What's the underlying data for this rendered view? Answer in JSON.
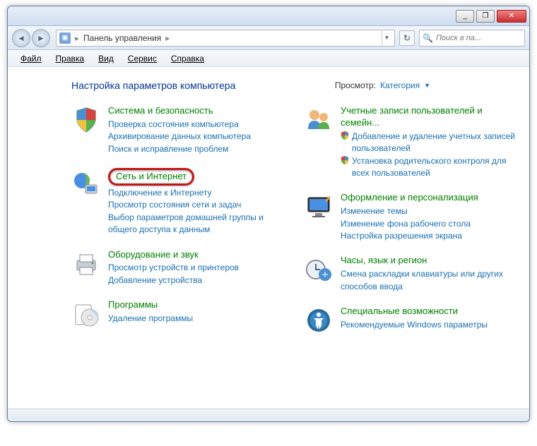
{
  "titlebar": {
    "min": "_",
    "max": "❐",
    "close": "✕"
  },
  "nav": {
    "back": "◄",
    "fwd": "►",
    "refresh": "↻"
  },
  "address": {
    "label": "Панель управления",
    "sep": "▸",
    "dropdown": "▾"
  },
  "search": {
    "placeholder": "Поиск в па..."
  },
  "menu": {
    "file": "Файл",
    "edit": "Правка",
    "view": "Вид",
    "service": "Сервис",
    "help": "Справка"
  },
  "header": {
    "title": "Настройка параметров компьютера",
    "viewLabel": "Просмотр:",
    "viewValue": "Категория",
    "arrow": "▼"
  },
  "left": [
    {
      "title": "Система и безопасность",
      "links": [
        {
          "t": "Проверка состояния компьютера"
        },
        {
          "t": "Архивирование данных компьютера"
        },
        {
          "t": "Поиск и исправление проблем"
        }
      ],
      "icon": "shield4"
    },
    {
      "title": "Сеть и Интернет",
      "hl": true,
      "links": [
        {
          "t": "Подключение к Интернету"
        },
        {
          "t": "Просмотр состояния сети и задач"
        },
        {
          "t": "Выбор параметров домашней группы и общего доступа к данным"
        }
      ],
      "icon": "globe"
    },
    {
      "title": "Оборудование и звук",
      "links": [
        {
          "t": "Просмотр устройств и принтеров"
        },
        {
          "t": "Добавление устройства"
        }
      ],
      "icon": "printer"
    },
    {
      "title": "Программы",
      "links": [
        {
          "t": "Удаление программы"
        }
      ],
      "icon": "disc"
    }
  ],
  "right": [
    {
      "title": "Учетные записи пользователей и семейн...",
      "links": [
        {
          "t": "Добавление и удаление учетных записей пользователей",
          "s": true
        },
        {
          "t": "Установка родительского контроля для всех пользователей",
          "s": true
        }
      ],
      "icon": "users"
    },
    {
      "title": "Оформление и персонализация",
      "links": [
        {
          "t": "Изменение темы"
        },
        {
          "t": "Изменение фона рабочего стола"
        },
        {
          "t": "Настройка разрешения экрана"
        }
      ],
      "icon": "monitor"
    },
    {
      "title": "Часы, язык и регион",
      "links": [
        {
          "t": "Смена раскладки клавиатуры или других способов ввода"
        }
      ],
      "icon": "clock"
    },
    {
      "title": "Специальные возможности",
      "links": [
        {
          "t": "Рекомендуемые Windows параметры"
        }
      ],
      "icon": "access"
    }
  ]
}
